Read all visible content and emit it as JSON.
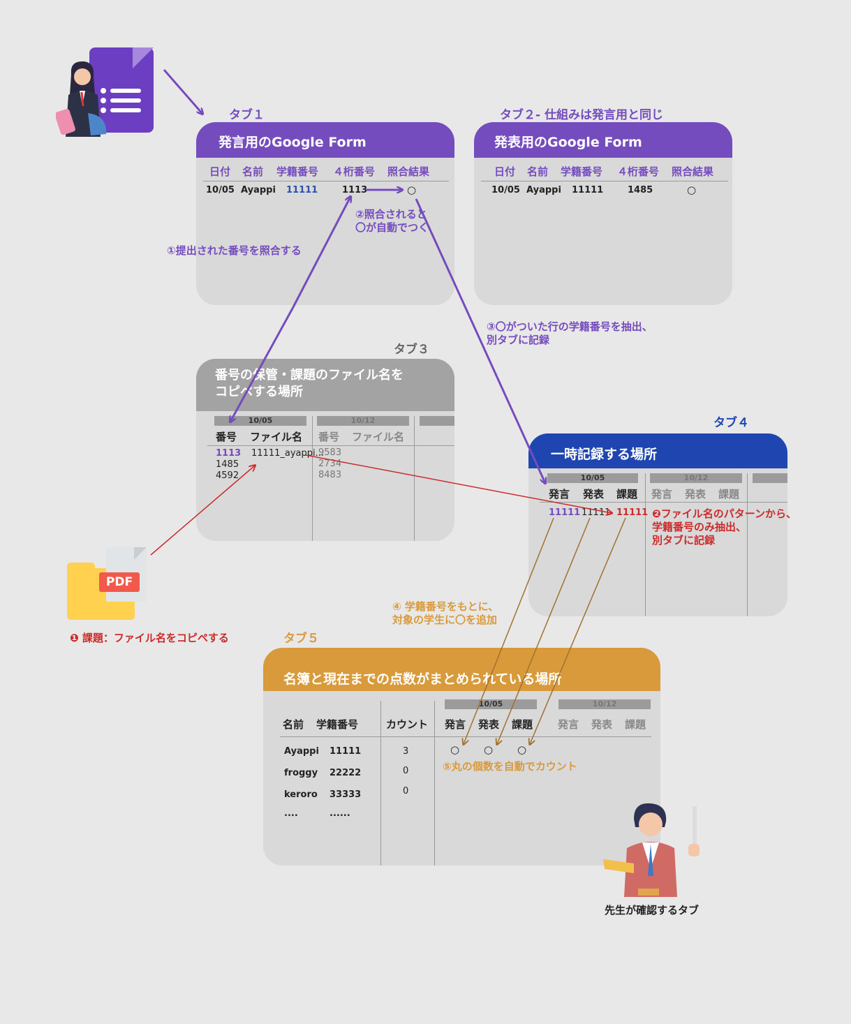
{
  "colors": {
    "background": "#e8e8e8",
    "panel": "#d9d9d9",
    "purple": "#754cbd",
    "blue": "#1f46b0",
    "orange": "#d99a3c",
    "red": "#cc2b2b",
    "brown_arrow": "#a0722d",
    "gray_header": "#a3a3a3"
  },
  "tab1": {
    "tab_label": "タブ１",
    "title": "発言用のGoogle Form",
    "headers": [
      "日付",
      "名前",
      "学籍番号",
      "４桁番号",
      "照合結果"
    ],
    "row": {
      "date": "10/05",
      "name": "Ayappi",
      "student_id": "11111",
      "code": "1113",
      "result": "○"
    }
  },
  "tab2": {
    "tab_label": "タブ２- 仕組みは発言用と同じ",
    "title": "発表用のGoogle Form",
    "headers": [
      "日付",
      "名前",
      "学籍番号",
      "４桁番号",
      "照合結果"
    ],
    "row": {
      "date": "10/05",
      "name": "Ayappi",
      "student_id": "11111",
      "code": "1485",
      "result": "○"
    }
  },
  "tab3": {
    "tab_label": "タブ３",
    "title_line1": "番号の保管・課題のファイル名を",
    "title_line2": "コピペする場所",
    "date1": "10/05",
    "date2": "10/12",
    "col_number": "番号",
    "col_filename": "ファイル名",
    "numbers1": [
      "1113",
      "1485",
      "4592"
    ],
    "filename1": "11111_ayappi...",
    "numbers2": [
      "9583",
      "2734",
      "8483"
    ]
  },
  "tab4": {
    "tab_label": "タブ４",
    "title": "一時記録する場所",
    "date1": "10/05",
    "date2": "10/12",
    "headers": [
      "発言",
      "発表",
      "課題"
    ],
    "values": [
      "11111",
      "11111",
      "11111"
    ]
  },
  "tab5": {
    "tab_label": "タブ５",
    "title": "名簿と現在までの点数がまとめられている場所",
    "col_name": "名前",
    "col_student_id": "学籍番号",
    "col_count": "カウント",
    "date1": "10/05",
    "date2": "10/12",
    "headers": [
      "発言",
      "発表",
      "課題"
    ],
    "marks": [
      "○",
      "○",
      "○"
    ],
    "rows": [
      {
        "name": "Ayappi",
        "id": "11111",
        "count": "3"
      },
      {
        "name": "froggy",
        "id": "22222",
        "count": "0"
      },
      {
        "name": "keroro",
        "id": "33333",
        "count": "0"
      },
      {
        "name": "....",
        "id": "......",
        "count": ""
      }
    ]
  },
  "notes": {
    "step1": "①提出された番号を照合する",
    "step2_line1": "②照合されると",
    "step2_line2": "〇が自動でつく",
    "step3_line1": "③〇がついた行の学籍番号を抽出、",
    "step3_line2": "別タブに記録",
    "stepA": "❶ 課題：ファイル名をコピペする",
    "stepB_line1": "❷ファイル名のパターンから、",
    "stepB_line2": "学籍番号のみ抽出、",
    "stepB_line3": "別タブに記録",
    "step4_line1": "④ 学籍番号をもとに、",
    "step4_line2": "対象の学生に〇を追加",
    "step5": "⑤丸の個数を自動でカウント"
  },
  "pdf_label": "PDF",
  "teacher_caption": "先生が確認するタブ"
}
